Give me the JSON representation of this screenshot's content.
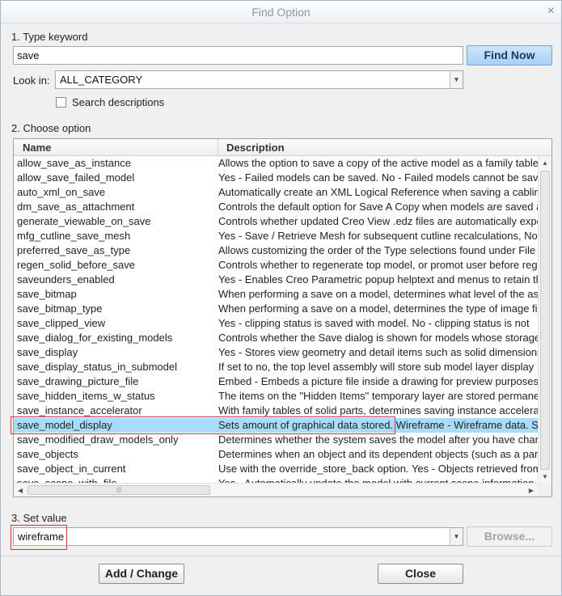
{
  "window": {
    "title": "Find Option",
    "close_glyph": "×"
  },
  "step1": {
    "label": "1.  Type keyword",
    "keyword_value": "save",
    "find_button": "Find Now",
    "look_in_label": "Look in:",
    "look_in_value": "ALL_CATEGORY",
    "search_descriptions_label": "Search descriptions",
    "search_descriptions_checked": false
  },
  "step2": {
    "label": "2.  Choose option",
    "columns": {
      "name": "Name",
      "description": "Description"
    },
    "rows": [
      {
        "name": "allow_save_as_instance",
        "desc": "Allows the option to save a copy of the active model as a family table"
      },
      {
        "name": "allow_save_failed_model",
        "desc": "Yes - Failed models can be saved. No - Failed models cannot be saved"
      },
      {
        "name": "auto_xml_on_save",
        "desc": "Automatically create an XML Logical Reference when saving a cabling"
      },
      {
        "name": "dm_save_as_attachment",
        "desc": "Controls the default option for Save A Copy when models are saved as"
      },
      {
        "name": "generate_viewable_on_save",
        "desc": "Controls whether updated Creo View .edz files are automatically exported"
      },
      {
        "name": "mfg_cutline_save_mesh",
        "desc": "Yes - Save / Retrieve Mesh for subsequent cutline recalculations, No"
      },
      {
        "name": "preferred_save_as_type",
        "desc": "Allows customizing the order of the Type selections found under File"
      },
      {
        "name": "regen_solid_before_save",
        "desc": "Controls whether to regenerate top model,  or promot user before regen"
      },
      {
        "name": "saveunders_enabled",
        "desc": "Yes - Enables Creo Parametric popup helptext and menus to retain the"
      },
      {
        "name": "save_bitmap",
        "desc": "When performing a save on a model, determines what level of the assembly"
      },
      {
        "name": "save_bitmap_type",
        "desc": "When performing a save on a model, determines the type of image file"
      },
      {
        "name": "save_clipped_view",
        "desc": "Yes - clipping status is saved with model. No - clipping status is not"
      },
      {
        "name": "save_dialog_for_existing_models",
        "desc": "Controls whether the Save dialog is shown for models whose storage"
      },
      {
        "name": "save_display",
        "desc": "Yes - Stores view geometry and detail items such as solid dimensions"
      },
      {
        "name": "save_display_status_in_submodel",
        "desc": "If set to no, the top level assembly will store sub model layer display"
      },
      {
        "name": "save_drawing_picture_file",
        "desc": "Embed - Embeds a picture file inside a drawing for preview purposes"
      },
      {
        "name": "save_hidden_items_w_status",
        "desc": "The items on the \"Hidden Items\" temporary layer are stored permanently"
      },
      {
        "name": "save_instance_accelerator",
        "desc": "With family tables of solid parts, determines saving instance accelerator"
      },
      {
        "name": "save_model_display",
        "desc": "Sets amount of graphical data stored. Wireframe - Wireframe data. Shading"
      },
      {
        "name": "save_modified_draw_models_only",
        "desc": "Determines whether the system saves the model after you have changed"
      },
      {
        "name": "save_objects",
        "desc": "Determines when an object and its dependent objects (such as a part"
      },
      {
        "name": "save_object_in_current",
        "desc": "Use with the override_store_back option. Yes - Objects retrieved from"
      },
      {
        "name": "save_scene_with_file",
        "desc": "Yes - Automatically update the model with current scene information"
      }
    ],
    "selected_row": "save_model_display"
  },
  "step3": {
    "label": "3.  Set value",
    "value": "wireframe",
    "browse_button": "Browse..."
  },
  "footer": {
    "add_change_button": "Add / Change",
    "close_button": "Close"
  }
}
